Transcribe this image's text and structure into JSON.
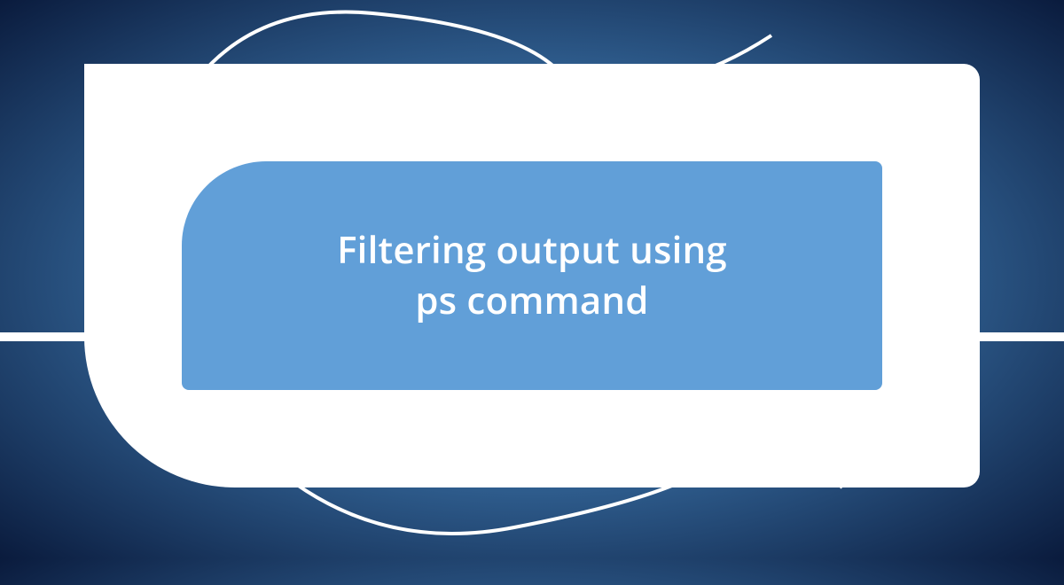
{
  "title": {
    "line1": "Filtering output using",
    "line2": "ps command"
  }
}
